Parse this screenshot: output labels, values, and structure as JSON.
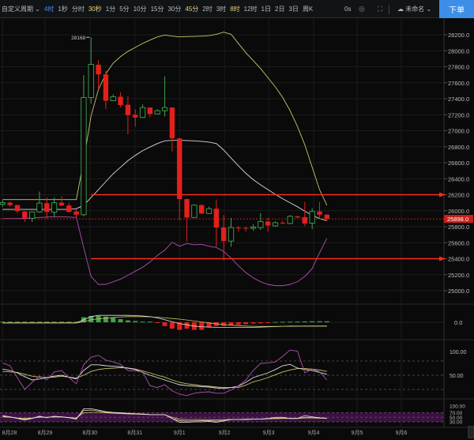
{
  "toolbar": {
    "period_menu": "自定义周期",
    "periods": [
      {
        "label": "4时",
        "state": "selected"
      },
      {
        "label": "1秒",
        "state": "normal"
      },
      {
        "label": "分时",
        "state": "normal"
      },
      {
        "label": "30秒",
        "state": "highlight"
      },
      {
        "label": "1分",
        "state": "normal"
      },
      {
        "label": "5分",
        "state": "normal"
      },
      {
        "label": "10分",
        "state": "normal"
      },
      {
        "label": "15分",
        "state": "normal"
      },
      {
        "label": "30分",
        "state": "normal"
      },
      {
        "label": "45分",
        "state": "highlight"
      },
      {
        "label": "2时",
        "state": "normal"
      },
      {
        "label": "3时",
        "state": "normal"
      },
      {
        "label": "8时",
        "state": "highlight"
      },
      {
        "label": "12时",
        "state": "normal"
      },
      {
        "label": "1日",
        "state": "normal"
      },
      {
        "label": "2日",
        "state": "normal"
      },
      {
        "label": "3日",
        "state": "normal"
      },
      {
        "label": "周K",
        "state": "normal"
      }
    ],
    "timer": "0s",
    "layout_name": "未命名",
    "order_button": "下单"
  },
  "colors": {
    "up": "#3fa34d",
    "down": "#e3201b",
    "upper_band": "#c9c46a",
    "mid_band": "#d8d8d8",
    "lower_band": "#b04fb0",
    "alert": "#ff2a1a",
    "accent": "#3d8ee8"
  },
  "chart_data": {
    "type": "candlestick",
    "price_axis": {
      "min": 25000,
      "max": 28200,
      "step": 200,
      "ticks": [
        "28200.0",
        "28000.0",
        "27800.0",
        "27600.0",
        "27400.0",
        "27200.0",
        "27000.0",
        "26800.0",
        "26600.0",
        "26400.0",
        "26200.0",
        "26000.0",
        "25800.0",
        "25600.0",
        "25400.0",
        "25200.0",
        "25000.0"
      ]
    },
    "last_price": {
      "value": 25898,
      "label": "25898.0"
    },
    "high_marker": {
      "value": 28168,
      "label": "28168",
      "candle_index": 12
    },
    "alert_lines": [
      {
        "value": 26200,
        "from_index": 12
      },
      {
        "value": 25400,
        "from_index": 12
      }
    ],
    "x_labels": [
      {
        "label": "8月28",
        "index": 0
      },
      {
        "label": "8月29",
        "index": 5.75
      },
      {
        "label": "8月30",
        "index": 11.85
      },
      {
        "label": "8月31",
        "index": 17.95
      },
      {
        "label": "9月1",
        "index": 24
      },
      {
        "label": "9月2",
        "index": 30.1
      },
      {
        "label": "9月3",
        "index": 36.1
      },
      {
        "label": "9月4",
        "index": 42.2
      },
      {
        "label": "9月5",
        "index": 48.1
      },
      {
        "label": "9月6",
        "index": 54.1
      }
    ],
    "candles": [
      [
        26080,
        26130,
        26050,
        26100
      ],
      [
        26100,
        26115,
        26050,
        26070
      ],
      [
        26070,
        26075,
        25970,
        25995
      ],
      [
        25990,
        25995,
        25860,
        25910
      ],
      [
        25905,
        25990,
        25860,
        25985
      ],
      [
        25985,
        26240,
        25975,
        26095
      ],
      [
        26095,
        26165,
        25900,
        25985
      ],
      [
        25980,
        26165,
        25920,
        26100
      ],
      [
        26100,
        26180,
        26060,
        26065
      ],
      [
        26065,
        26100,
        25980,
        25985
      ],
      [
        25990,
        26020,
        25920,
        25950
      ],
      [
        25950,
        27695,
        25930,
        27415
      ],
      [
        27415,
        28168,
        27340,
        27830
      ],
      [
        27825,
        27880,
        27515,
        27705
      ],
      [
        27705,
        27750,
        27270,
        27375
      ],
      [
        27375,
        27455,
        27370,
        27425
      ],
      [
        27425,
        27480,
        27290,
        27320
      ],
      [
        27325,
        27430,
        26955,
        27195
      ],
      [
        27200,
        27270,
        27050,
        27165
      ],
      [
        27165,
        27330,
        27160,
        27290
      ],
      [
        27290,
        27290,
        27170,
        27210
      ],
      [
        27210,
        27270,
        27205,
        27250
      ],
      [
        27250,
        27680,
        27180,
        27290
      ],
      [
        27290,
        27290,
        26740,
        26905
      ],
      [
        26905,
        26905,
        25880,
        26145
      ],
      [
        26145,
        26150,
        25615,
        25915
      ],
      [
        25915,
        26080,
        25915,
        26070
      ],
      [
        26070,
        26080,
        25960,
        25965
      ],
      [
        25965,
        26050,
        25960,
        26025
      ],
      [
        26025,
        26140,
        25550,
        25790
      ],
      [
        25790,
        25945,
        25380,
        25620
      ],
      [
        25620,
        25910,
        25550,
        25790
      ],
      [
        25790,
        25805,
        25740,
        25780
      ],
      [
        25785,
        25800,
        25740,
        25780
      ],
      [
        25780,
        25830,
        25750,
        25795
      ],
      [
        25790,
        25970,
        25760,
        25865
      ],
      [
        25865,
        25910,
        25740,
        25815
      ],
      [
        25810,
        25865,
        25800,
        25850
      ],
      [
        25850,
        25875,
        25830,
        25840
      ],
      [
        25840,
        25945,
        25830,
        25930
      ],
      [
        25930,
        25935,
        25910,
        25915
      ],
      [
        25920,
        26110,
        25810,
        25840
      ],
      [
        25845,
        26030,
        25770,
        25990
      ],
      [
        25990,
        26110,
        25910,
        25950
      ],
      [
        25950,
        25955,
        25870,
        25898
      ]
    ],
    "bollinger": {
      "upper": [
        26139,
        26139,
        26139,
        26139,
        26139,
        26139,
        26139,
        26139,
        26139,
        26139,
        26139,
        26626,
        27186,
        27515,
        27713,
        27844,
        27927,
        27992,
        28042,
        28091,
        28134,
        28173,
        28196,
        28183,
        28173,
        28177,
        28180,
        28183,
        28190,
        28206,
        28233,
        28206,
        28091,
        27976,
        27877,
        27778,
        27663,
        27548,
        27416,
        27252,
        27054,
        26824,
        26544,
        26264,
        26067
      ],
      "middle": [
        26017,
        26017,
        26017,
        26017,
        26017,
        26017,
        26017,
        26017,
        26017,
        26017,
        26025,
        26067,
        26165,
        26264,
        26363,
        26462,
        26544,
        26626,
        26692,
        26751,
        26797,
        26840,
        26873,
        26880,
        26880,
        26877,
        26873,
        26867,
        26857,
        26840,
        26758,
        26659,
        26560,
        26468,
        26389,
        26323,
        26264,
        26205,
        26149,
        26100,
        26050,
        25994,
        25941,
        25902,
        25876
      ],
      "lower": [
        25902,
        25902,
        25902,
        25905,
        25910,
        25915,
        25920,
        25925,
        25925,
        25920,
        25915,
        25540,
        25178,
        25079,
        25079,
        25112,
        25145,
        25194,
        25244,
        25293,
        25359,
        25441,
        25507,
        25606,
        25556,
        25589,
        25573,
        25580,
        25556,
        25540,
        25490,
        25408,
        25310,
        25227,
        25161,
        25112,
        25079,
        25063,
        25063,
        25079,
        25112,
        25178,
        25277,
        25474,
        25655
      ]
    },
    "macd": {
      "zero_label": "0.0",
      "histogram": [
        0.5,
        0.5,
        0.5,
        0.5,
        0.5,
        0.5,
        0.5,
        0.5,
        0.5,
        0.5,
        0.5,
        4,
        5,
        5,
        4.5,
        3.5,
        2.5,
        1.5,
        1,
        0.5,
        0.5,
        -0.3,
        -3,
        -5,
        -6,
        -5,
        -6,
        -6,
        -4,
        -3,
        -3,
        -2.5,
        -2,
        -1.5,
        -1,
        -0.8,
        -0.5,
        0.3,
        0.4,
        0.5,
        0.6,
        0.7,
        0.8,
        0.8,
        0.8
      ],
      "dif": [
        -0.5,
        -0.5,
        -0.5,
        -0.5,
        -0.5,
        -0.5,
        -0.5,
        -0.5,
        -0.5,
        -0.5,
        -0.5,
        2,
        4.5,
        5.5,
        5.5,
        5.5,
        5.5,
        5.5,
        5.3,
        5,
        4.5,
        3.5,
        2,
        0.5,
        -1,
        -2,
        -3,
        -3.5,
        -3.8,
        -4,
        -4,
        -4,
        -4,
        -4,
        -4,
        -3.8,
        -3.6,
        -3.4,
        -3.2,
        -3,
        -3,
        -3,
        -3,
        -3,
        -3
      ],
      "dea": [
        -0.5,
        -0.5,
        -0.5,
        -0.5,
        -0.5,
        -0.5,
        -0.5,
        -0.5,
        -0.5,
        -0.5,
        -0.5,
        0.5,
        2,
        2.8,
        3.3,
        3.8,
        4.2,
        4.5,
        4.5,
        4.5,
        4.3,
        4,
        3.5,
        3,
        2.5,
        1.8,
        1,
        0.3,
        -0.5,
        -1.2,
        -1.8,
        -2.3,
        -2.7,
        -3,
        -3.2,
        -3.3,
        -3.3,
        -3.3,
        -3.2,
        -3.2,
        -3.1,
        -3,
        -3,
        -3,
        -3
      ]
    },
    "kdj": {
      "ticks": [
        "100.00",
        "50.00"
      ],
      "k": [
        63,
        60,
        55,
        47,
        40,
        42,
        45,
        48,
        50,
        46,
        42,
        60,
        72,
        72,
        70,
        69,
        68,
        65,
        62,
        56,
        50,
        45,
        40,
        35,
        30,
        28,
        27,
        26,
        25,
        23,
        22,
        24,
        27,
        35,
        45,
        50,
        55,
        62,
        70,
        73,
        65,
        62,
        60,
        56,
        52
      ],
      "d": [
        58,
        57,
        56,
        52,
        48,
        46,
        45,
        46,
        48,
        46,
        44,
        50,
        58,
        62,
        64,
        65,
        66,
        65,
        63,
        59,
        55,
        50,
        46,
        40,
        35,
        32,
        30,
        28,
        27,
        25,
        24,
        24,
        24,
        29,
        36,
        40,
        45,
        51,
        57,
        61,
        64,
        64,
        63,
        61,
        58
      ],
      "j": [
        76,
        70,
        45,
        20,
        35,
        48,
        40,
        57,
        60,
        45,
        32,
        72,
        88,
        92,
        82,
        78,
        73,
        60,
        59,
        57,
        28,
        24,
        30,
        17,
        10,
        7,
        12,
        14,
        15,
        12,
        12,
        19,
        28,
        40,
        60,
        75,
        76,
        78,
        90,
        103,
        101,
        55,
        63,
        57,
        40
      ]
    },
    "rsi": {
      "ticks": [
        "100.00",
        "70.00",
        "50.00",
        "30.00"
      ],
      "r1": [
        58,
        52,
        45,
        38,
        45,
        55,
        48,
        55,
        52,
        48,
        42,
        88,
        88,
        82,
        75,
        72,
        70,
        68,
        66,
        65,
        62,
        62,
        62,
        45,
        28,
        28,
        30,
        30,
        32,
        28,
        34,
        40,
        40,
        40,
        42,
        42,
        45,
        50,
        50,
        45,
        45,
        58,
        52,
        48,
        45
      ],
      "r2": [
        55,
        52,
        46,
        42,
        46,
        52,
        50,
        53,
        52,
        49,
        45,
        80,
        82,
        78,
        73,
        70,
        68,
        66,
        65,
        64,
        62,
        62,
        62,
        45,
        35,
        34,
        34,
        35,
        35,
        33,
        36,
        40,
        40,
        41,
        42,
        42,
        44,
        46,
        47,
        45,
        45,
        50,
        50,
        48,
        46
      ],
      "r3": [
        52,
        50,
        47,
        45,
        47,
        50,
        50,
        51,
        51,
        49,
        47,
        70,
        72,
        72,
        70,
        68,
        67,
        65,
        64,
        63,
        62,
        62,
        61,
        50,
        42,
        40,
        40,
        40,
        40,
        39,
        40,
        41,
        41,
        42,
        42,
        42,
        43,
        44,
        45,
        45,
        45,
        47,
        47,
        46,
        46
      ]
    }
  }
}
